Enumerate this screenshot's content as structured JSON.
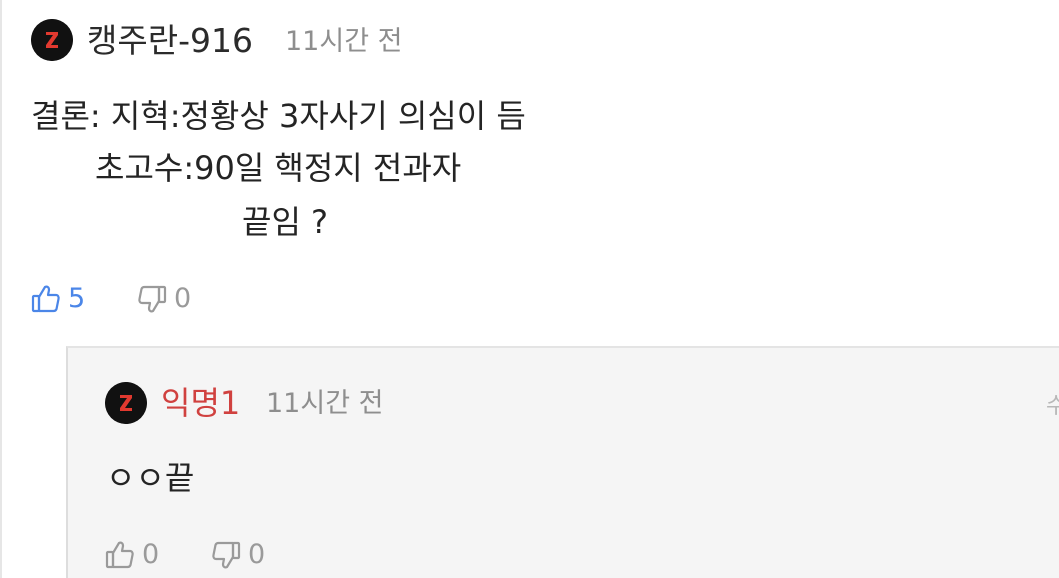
{
  "comment": {
    "username": "캥주란-916",
    "time": "11시간 전",
    "body_lines": [
      "결론: 지혁:정황상 3자사기 의심이 듬",
      "초고수:90일 핵정지 전과자",
      "끝임 ?"
    ],
    "likes": "5",
    "dislikes": "0",
    "like_color": "#4b86e8"
  },
  "reply": {
    "username": "익명1",
    "time": "11시간 전",
    "body": "ㅇㅇ끝",
    "likes": "0",
    "dislikes": "0",
    "username_color": "#d0413f",
    "edge_text": "수"
  },
  "icons": {
    "avatar": "app-logo-icon",
    "like": "thumbs-up-icon",
    "dislike": "thumbs-down-icon"
  }
}
